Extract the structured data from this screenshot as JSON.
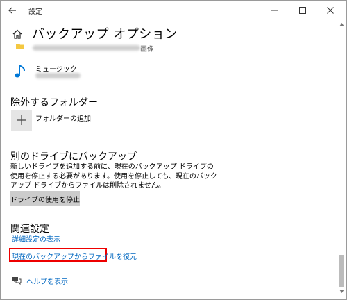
{
  "window": {
    "title": "設定"
  },
  "page": {
    "title": "バックアップ オプション"
  },
  "folders": {
    "row1_suffix": "画像",
    "music_label": "ミュージック"
  },
  "exclude": {
    "heading": "除外するフォルダー",
    "add_label": "フォルダーの追加"
  },
  "other_drive": {
    "heading": "別のドライブにバックアップ",
    "description": "新しいドライブを追加する前に、現在のバックアップ ドライブの使用を停止する必要があります。使用を停止しても、現在のバックアップ ドライブからファイルは削除されません。",
    "stop_button": "ドライブの使用を停止"
  },
  "related": {
    "heading": "関連設定",
    "advanced_link": "詳細設定の表示",
    "restore_link": "現在のバックアップからファイルを復元"
  },
  "help": {
    "label": "ヘルプを表示"
  },
  "colors": {
    "link": "#0067c0",
    "highlight": "#e00000",
    "music_icon": "#0078d7",
    "folder_icon": "#f4c842"
  }
}
